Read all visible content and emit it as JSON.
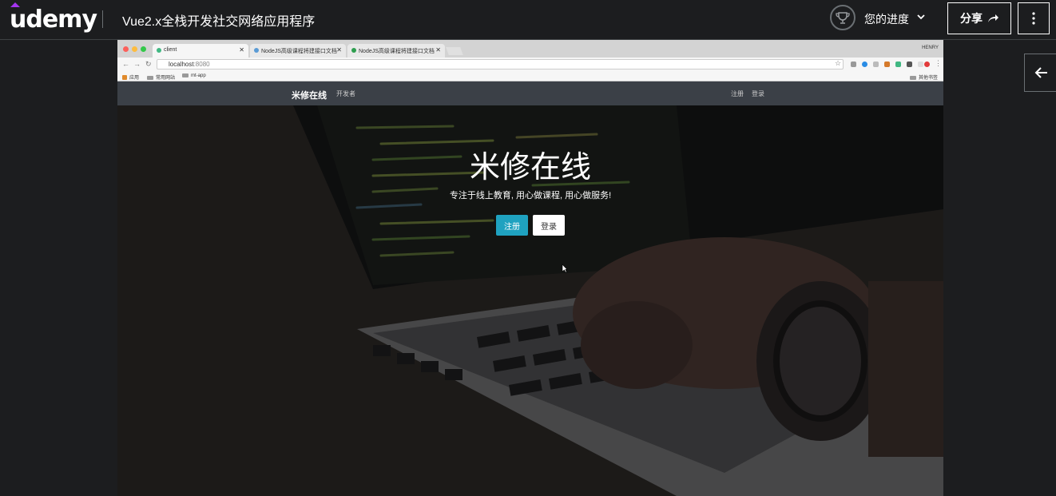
{
  "header": {
    "logo": "udemy",
    "course_title": "Vue2.x全栈开发社交网络应用程序",
    "progress_label": "您的进度",
    "share_label": "分享",
    "accent_color": "#a435f0"
  },
  "browser": {
    "tabs": [
      {
        "label": "client",
        "active": true
      },
      {
        "label": "NodeJS高级课程将建接口文档",
        "active": false
      },
      {
        "label": "NodeJS高级课程将建接口文档",
        "active": false
      }
    ],
    "profile": "HENRY",
    "url_host": "localhost",
    "url_port": ":8080",
    "bookmarks": [
      "应用",
      "常用网站",
      "mt-app"
    ],
    "other_bookmarks": "其他书签"
  },
  "site": {
    "brand": "米修在线",
    "dev_link": "开发者",
    "register_link": "注册",
    "login_link": "登录",
    "hero_title": "米修在线",
    "hero_subtitle": "专注于线上教育, 用心做课程, 用心做服务!",
    "hero_register": "注册",
    "hero_login": "登录",
    "primary_color": "#1fa2c0"
  }
}
